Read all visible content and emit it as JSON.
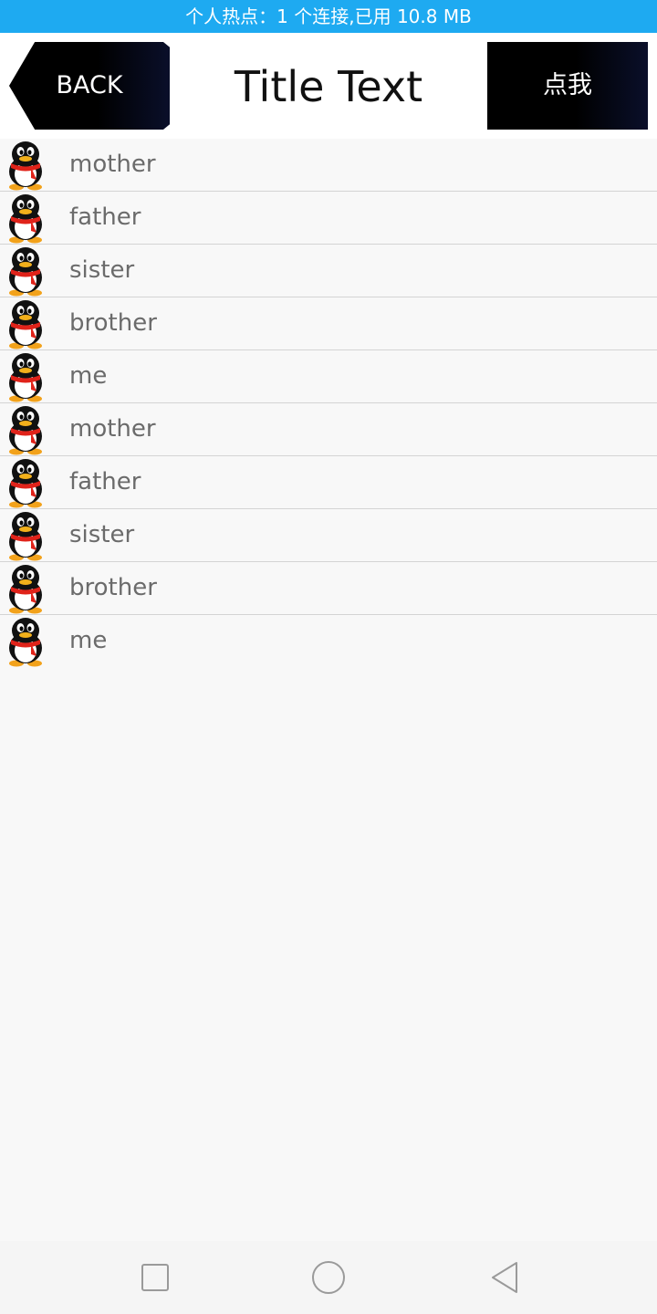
{
  "status_bar": {
    "text": "个人热点：1 个连接,已用 10.8 MB",
    "color": "#1eaaf1"
  },
  "title_bar": {
    "back_label": "BACK",
    "title": "Title Text",
    "action_label": "点我"
  },
  "list": {
    "items": [
      {
        "label": "mother",
        "icon": "penguin-avatar-icon"
      },
      {
        "label": "father",
        "icon": "penguin-avatar-icon"
      },
      {
        "label": "sister",
        "icon": "penguin-avatar-icon"
      },
      {
        "label": "brother",
        "icon": "penguin-avatar-icon"
      },
      {
        "label": "me",
        "icon": "penguin-avatar-icon"
      },
      {
        "label": "mother",
        "icon": "penguin-avatar-icon"
      },
      {
        "label": "father",
        "icon": "penguin-avatar-icon"
      },
      {
        "label": "sister",
        "icon": "penguin-avatar-icon"
      },
      {
        "label": "brother",
        "icon": "penguin-avatar-icon"
      },
      {
        "label": "me",
        "icon": "penguin-avatar-icon"
      }
    ]
  },
  "nav_bar": {
    "icons": [
      "recents-square-icon",
      "home-circle-icon",
      "back-triangle-icon"
    ]
  }
}
